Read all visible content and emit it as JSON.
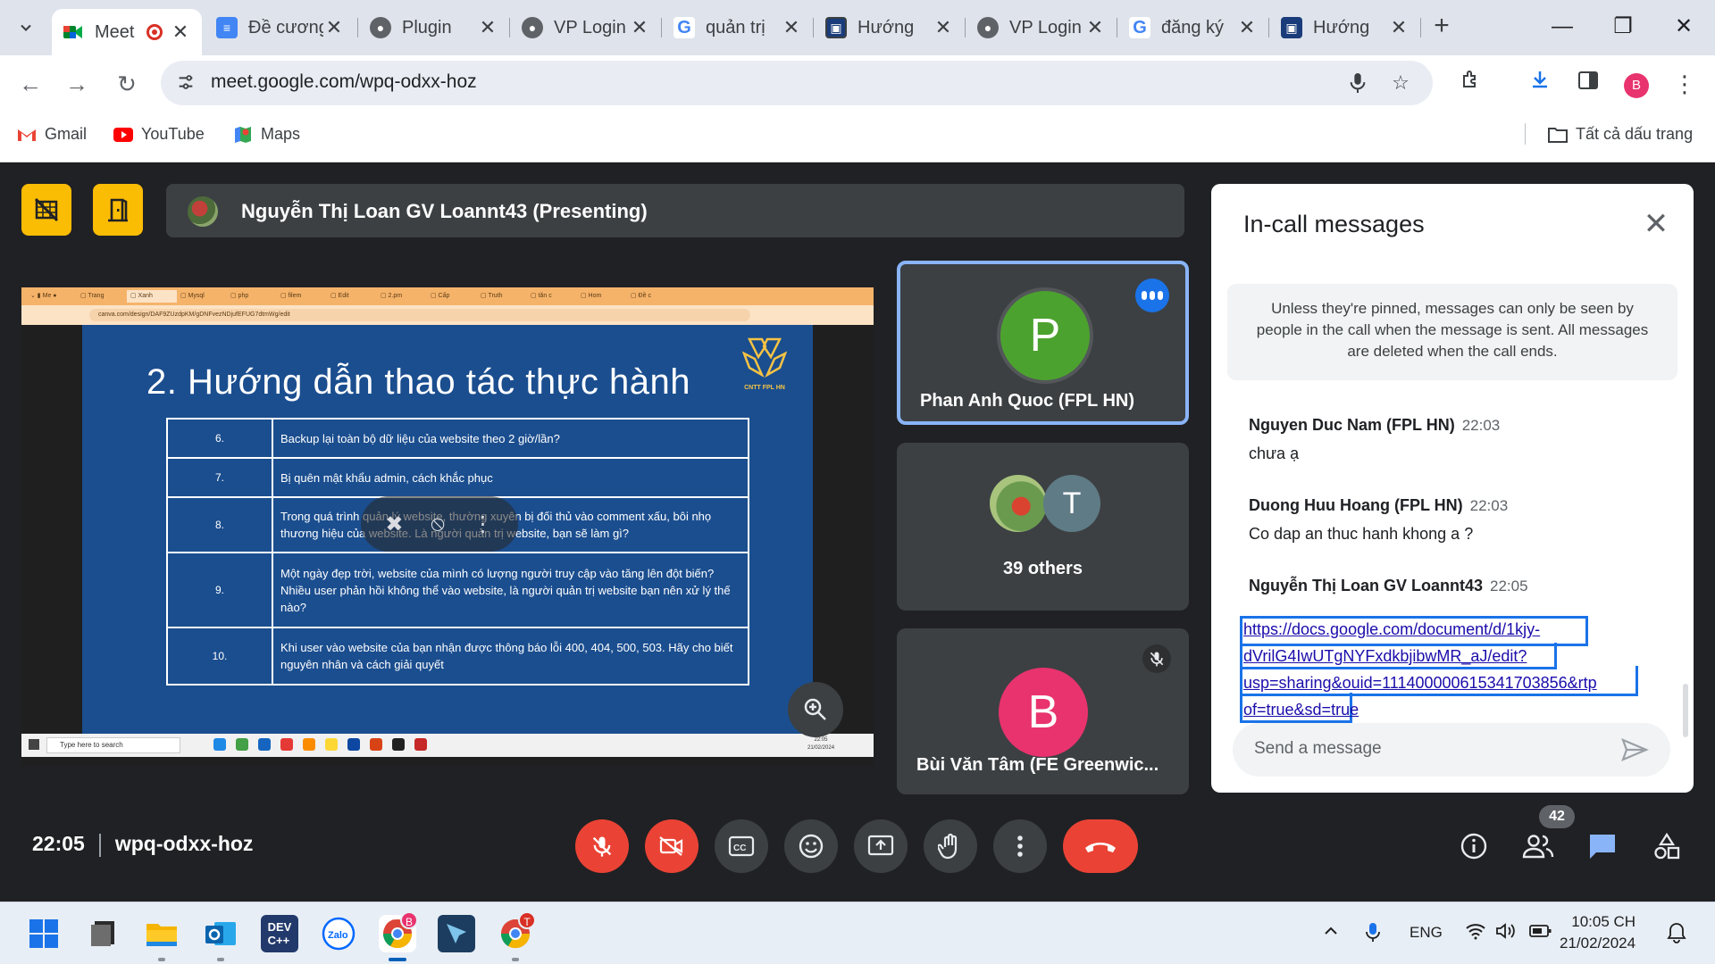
{
  "browser": {
    "tabs": [
      {
        "label": "Meet",
        "active": true,
        "recording": true,
        "icon": "google-meet-icon"
      },
      {
        "label": "Đề cương",
        "icon": "google-docs-icon"
      },
      {
        "label": "Plugin",
        "icon": "globe-icon"
      },
      {
        "label": "VP Login",
        "icon": "globe-icon"
      },
      {
        "label": "quản trị",
        "icon": "google-g-icon"
      },
      {
        "label": "Hướng",
        "icon": "site-favicon"
      },
      {
        "label": "VP Login",
        "icon": "globe-icon"
      },
      {
        "label": "đăng ký",
        "icon": "google-g-icon"
      },
      {
        "label": "Hướng",
        "icon": "site-favicon"
      }
    ],
    "url": "meet.google.com/wpq-odxx-hoz",
    "profile_initial": "B",
    "bookmarks": [
      {
        "label": "Gmail",
        "icon": "gmail-icon"
      },
      {
        "label": "YouTube",
        "icon": "youtube-icon"
      },
      {
        "label": "Maps",
        "icon": "maps-icon"
      }
    ],
    "all_bookmarks_label": "Tất cả dấu trang"
  },
  "meet": {
    "presenter_label": "Nguyễn Thị Loan GV Loannt43 (Presenting)",
    "shared_screen": {
      "url": "canva.com/design/DAF9ZUzdpKM/gDNFvezNDjufEFUG7dtmWg/edit",
      "slide_title": "2. Hướng dẫn thao tác thực hành",
      "logo_text": "CNTT FPL HN",
      "rows": [
        {
          "num": "6.",
          "text": "Backup lại toàn bộ dữ liệu của website theo 2 giờ/lần?"
        },
        {
          "num": "7.",
          "text": "Bị quên mật khẩu admin, cách khắc phục"
        },
        {
          "num": "8.",
          "text": "Trong quá trình quản lý website, thường xuyên bị đối thủ vào comment xấu, bôi nhọ thương hiệu của website. Là người quản trị website, bạn sẽ làm gì?"
        },
        {
          "num": "9.",
          "text": "Một ngày đẹp trời, website của mình có lượng người truy cập vào tăng lên đột biến? Nhiều user phản hồi không thể vào website, là người quản trị website bạn nên xử lý thế nào?"
        },
        {
          "num": "10.",
          "text": "Khi user vào website của bạn nhận được thông báo lỗi 400, 404, 500, 503. Hãy cho biết nguyên nhân và cách giải quyết"
        }
      ],
      "taskbar_search": "Type here to search",
      "clock_time": "22:05",
      "clock_date": "21/02/2024"
    },
    "participants": [
      {
        "name": "Phan Anh Quoc (FPL HN)",
        "initial": "P",
        "color": "#4ca22f",
        "speaking": true
      },
      {
        "name": "39 others",
        "initial": "T",
        "color": "#5f7b85"
      },
      {
        "name": "Bùi Văn Tâm (FE Greenwic...",
        "initial": "B",
        "color": "#e8336e",
        "muted": true
      }
    ],
    "chat": {
      "title": "In-call messages",
      "notice": "Unless they're pinned, messages can only be seen by people in the call when the message is sent. All messages are deleted when the call ends.",
      "messages": [
        {
          "author": "Nguyen Duc Nam (FPL HN)",
          "time": "22:03",
          "text": "chưa ạ"
        },
        {
          "author": "Duong Huu Hoang (FPL HN)",
          "time": "22:03",
          "text": "Co dap an thuc hanh khong a ?"
        },
        {
          "author": "Nguyễn Thị Loan GV Loannt43",
          "time": "22:05",
          "link_lines": [
            "https://docs.google.com/document/d/1kjy-",
            "dVrilG4IwUTgNYFxdkbjibwMR_aJ/edit?",
            "usp=sharing&ouid=111400000615341703856&rtp",
            "of=true&sd=true"
          ]
        }
      ],
      "input_placeholder": "Send a message"
    },
    "clock": "22:05",
    "meeting_code": "wpq-odxx-hoz",
    "people_count": "42"
  },
  "taskbar": {
    "apps": [
      "windows-start",
      "file-app",
      "file-explorer",
      "outlook",
      "dev-cpp",
      "zalo",
      "chrome-b",
      "remote-app",
      "chrome-t"
    ],
    "chrome_b_badge": "B",
    "chrome_t_badge": "T",
    "lang": "ENG",
    "time": "10:05 CH",
    "date": "21/02/2024"
  }
}
